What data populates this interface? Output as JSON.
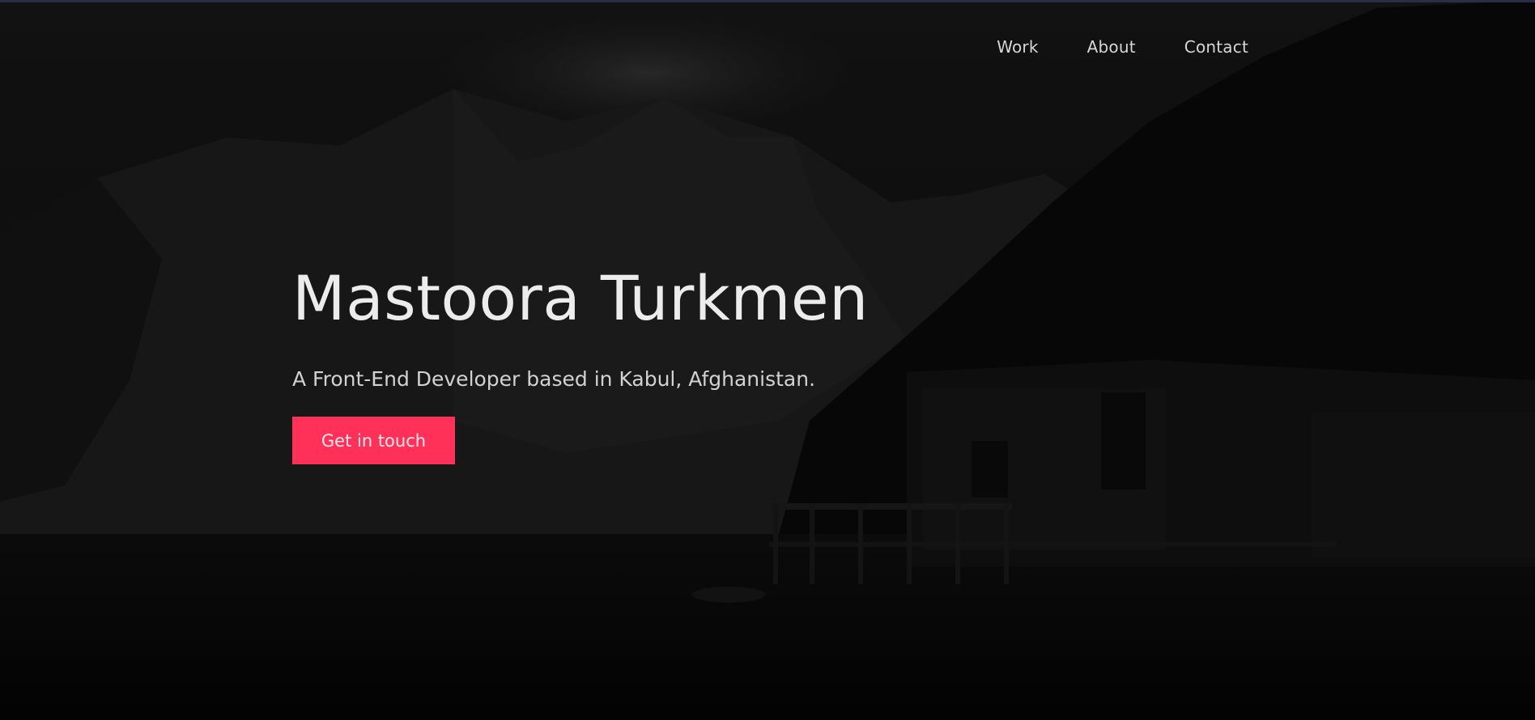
{
  "nav": {
    "items": [
      {
        "label": "Work"
      },
      {
        "label": "About"
      },
      {
        "label": "Contact"
      }
    ]
  },
  "hero": {
    "title": "Mastoora Turkmen",
    "subtitle": "A Front-End Developer based in Kabul, Afghanistan.",
    "cta_label": "Get in touch"
  },
  "colors": {
    "background": "#070707",
    "accent": "#ff3158",
    "text_primary": "#ececec",
    "text_secondary": "#d2d2d2",
    "top_strip": "#2a2f44"
  }
}
